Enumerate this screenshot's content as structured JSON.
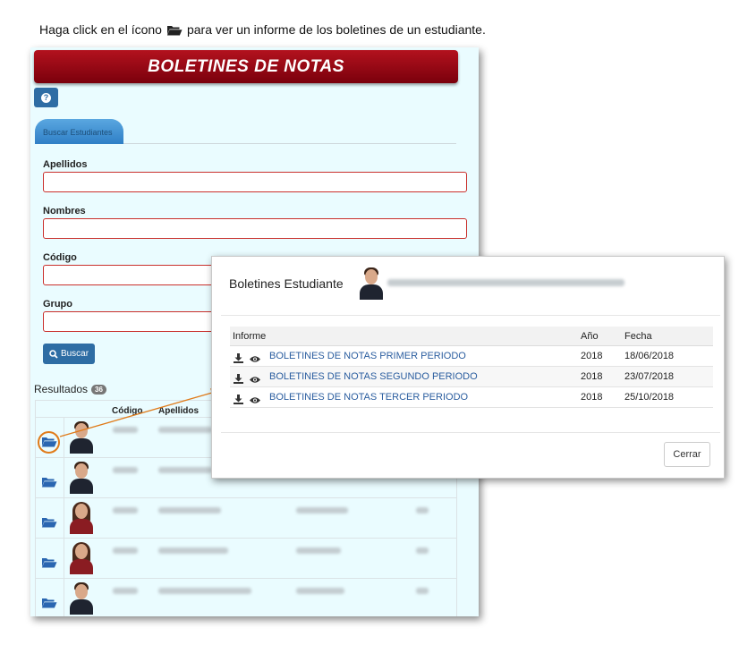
{
  "instruction": {
    "before": "Haga click en el ícono",
    "after": "para ver un informe de los boletines de un estudiante."
  },
  "app": {
    "banner_title": "BOLETINES DE NOTAS",
    "tab_label": "Buscar Estudiantes",
    "fields": {
      "apellidos_label": "Apellidos",
      "nombres_label": "Nombres",
      "codigo_label": "Código",
      "grupo_label": "Grupo"
    },
    "search_button": "Buscar",
    "results_label": "Resultados",
    "results_count": "36",
    "columns": {
      "codigo": "Código",
      "apellidos": "Apellidos"
    }
  },
  "modal": {
    "title": "Boletines Estudiante",
    "headers": {
      "informe": "Informe",
      "anio": "Año",
      "fecha": "Fecha"
    },
    "rows": [
      {
        "name": "BOLETINES DE NOTAS PRIMER PERIODO",
        "year": "2018",
        "date": "18/06/2018"
      },
      {
        "name": "BOLETINES DE NOTAS SEGUNDO PERIODO",
        "year": "2018",
        "date": "23/07/2018"
      },
      {
        "name": "BOLETINES DE NOTAS TERCER PERIODO",
        "year": "2018",
        "date": "25/10/2018"
      }
    ],
    "close_button": "Cerrar"
  },
  "colors": {
    "banner": "#9b0a16",
    "primary": "#2e6da4",
    "link": "#2a5d9f",
    "highlight": "#e07b1a",
    "invalid_border": "#c9302c",
    "panel_bg": "#eafcff"
  },
  "icons": [
    "folder-open-icon",
    "question-icon",
    "search-icon",
    "download-icon",
    "eye-icon",
    "arrow-icon"
  ]
}
